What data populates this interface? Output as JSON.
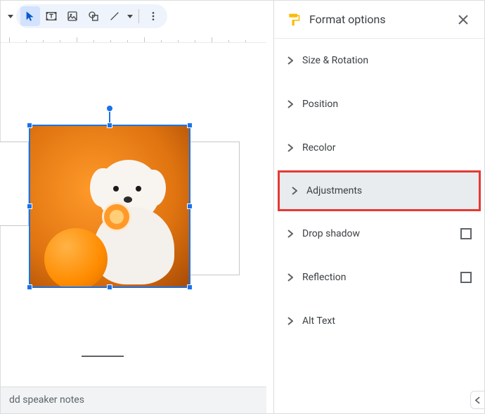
{
  "toolbar": {
    "select_tool": "Select",
    "textbox_tool": "Text box",
    "image_tool": "Insert image",
    "shape_tool": "Shape",
    "line_tool": "Line",
    "more_tool": "More"
  },
  "panel": {
    "title": "Format options",
    "close": "Close",
    "sections": {
      "size_rotation": "Size & Rotation",
      "position": "Position",
      "recolor": "Recolor",
      "adjustments": "Adjustments",
      "drop_shadow": "Drop shadow",
      "reflection": "Reflection",
      "alt_text": "Alt Text"
    }
  },
  "notes": {
    "placeholder": "dd speaker notes"
  },
  "image": {
    "description": "Selected image of a white fluffy dog holding an orange slice next to a whole orange on an orange background"
  }
}
